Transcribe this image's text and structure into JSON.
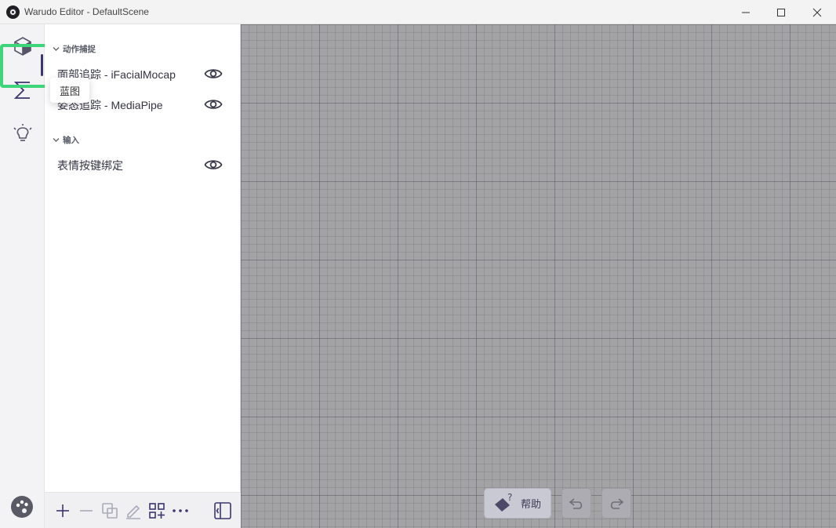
{
  "window": {
    "title": "Warudo Editor - DefaultScene"
  },
  "activity_bar": {
    "items": [
      {
        "icon": "cube-icon",
        "label": ""
      },
      {
        "icon": "sigma-icon",
        "label": "蓝图",
        "selected": true
      },
      {
        "icon": "lightbulb-icon",
        "label": ""
      }
    ],
    "bottom_icon": "palette-icon"
  },
  "tooltip": {
    "text": "蓝图"
  },
  "panel": {
    "groups": [
      {
        "title": "动作捕捉",
        "items": [
          {
            "label": "面部追踪 - iFacialMocap"
          },
          {
            "label": "姿态追踪 - MediaPipe"
          }
        ]
      },
      {
        "title": "输入",
        "items": [
          {
            "label": "表情按键绑定"
          }
        ]
      }
    ]
  },
  "toolbar": {
    "icons": [
      "add-icon",
      "remove-icon",
      "duplicate-icon",
      "rename-icon",
      "add-grid-icon",
      "more-icon",
      "collapse-panel-icon"
    ]
  },
  "canvas": {
    "help_label": "帮助",
    "undo_icon": "undo-icon",
    "redo_icon": "redo-icon"
  }
}
